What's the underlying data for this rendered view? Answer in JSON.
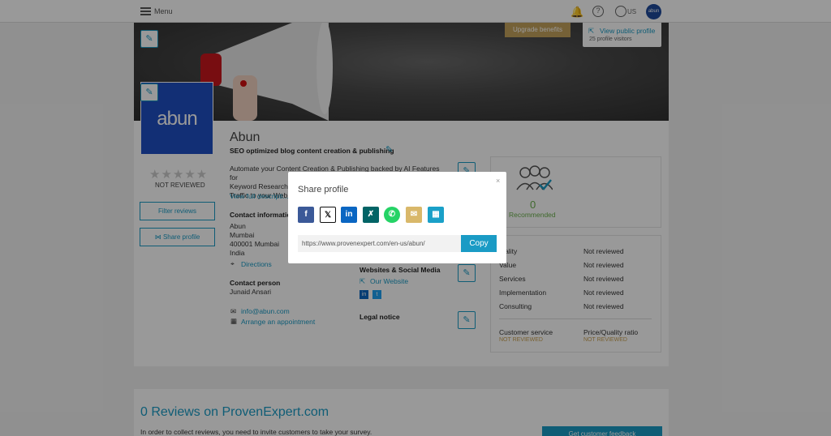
{
  "topbar": {
    "menu_label": "Menu",
    "lang": "US",
    "avatar": "abun"
  },
  "banner": {
    "upgrade": "Upgrade benefits",
    "view_public": "View public profile",
    "visitors": "25 profile visitors"
  },
  "profile": {
    "logo_text": "abun",
    "name": "Abun",
    "tagline": "SEO optimized blog content creation & publishing",
    "not_reviewed": "NOT REVIEWED",
    "filter_reviews": "Filter reviews",
    "share_profile": "Share profile",
    "description": [
      "Automate your Content Creation & Publishing backed by AI Features for",
      "Keyword Research...",
      "Traffic to your Web..."
    ],
    "view_full": "View full descripti...",
    "contact_info_label": "Contact informatio...",
    "address": [
      "Abun",
      "Mumbai",
      "400001 Mumbai",
      "India"
    ],
    "directions": "Directions",
    "contact_person_label": "Contact person",
    "contact_person": "Junaid Ansari",
    "email": "info@abun.com",
    "appointment": "Arrange an appointment",
    "websites_label": "Websites & Social Media",
    "our_website": "Our Website",
    "legal_notice": "Legal notice"
  },
  "recommend": {
    "count": "0",
    "label": "Recommended"
  },
  "ratings": {
    "items": [
      {
        "label": "...ality",
        "value": "Not reviewed"
      },
      {
        "label": "Value",
        "value": "Not reviewed"
      },
      {
        "label": "Services",
        "value": "Not reviewed"
      },
      {
        "label": "Implementation",
        "value": "Not reviewed"
      },
      {
        "label": "Consulting",
        "value": "Not reviewed"
      }
    ],
    "customer_service": "Customer service",
    "price_quality": "Price/Quality ratio",
    "not_reviewed_caps": "NOT REVIEWED"
  },
  "reviews": {
    "title": "0 Reviews on ProvenExpert.com",
    "subtitle": "In order to collect reviews, you need to invite customers to take your survey.",
    "button": "Get customer feedback"
  },
  "modal": {
    "title": "Share profile",
    "close": "×",
    "url": "https://www.provenexpert.com/en-us/abun/",
    "copy": "Copy"
  },
  "colors": {
    "accent": "#1a9bc5",
    "logo_bg": "#1e4fc4",
    "facebook": "#3b5998",
    "x": "#111111",
    "linkedin": "#0a66c2",
    "xing": "#026466",
    "whatsapp": "#25d366",
    "email": "#d9b86a",
    "qr": "#1aa0c8"
  }
}
